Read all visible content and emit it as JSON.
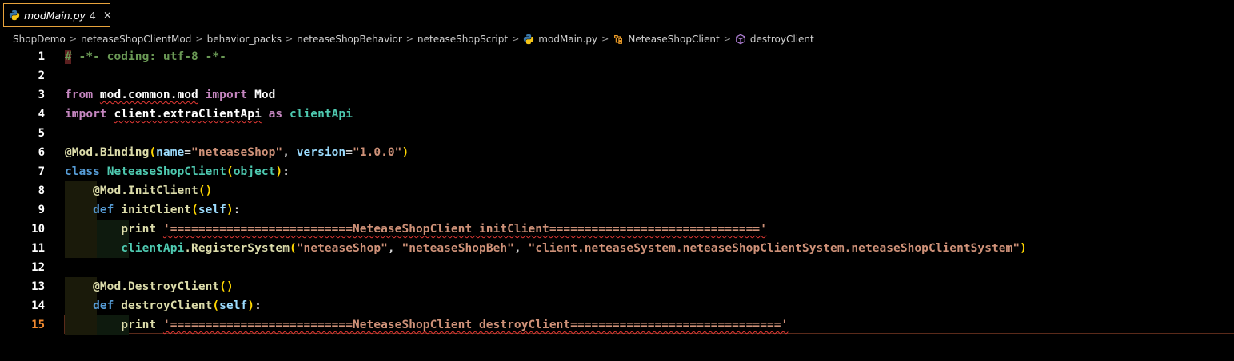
{
  "tab": {
    "title": "modMain.py",
    "badge": "4",
    "close": "×"
  },
  "breadcrumb": {
    "items": [
      "ShopDemo",
      "neteaseShopClientMod",
      "behavior_packs",
      "neteaseShopBehavior",
      "neteaseShopScript",
      "modMain.py",
      "NeteaseShopClient",
      "destroyClient"
    ],
    "separator": ">"
  },
  "editor": {
    "active_line": "15",
    "lines": [
      {
        "n": "1",
        "tokens": [
          {
            "t": "# -*- coding: utf-8 -*-",
            "c": "c-comment"
          }
        ]
      },
      {
        "n": "2",
        "tokens": []
      },
      {
        "n": "3",
        "tokens": [
          {
            "t": "from ",
            "c": "c-kw"
          },
          {
            "t": "mod.common.mod",
            "c": "c-module squiggle"
          },
          {
            "t": " import ",
            "c": "c-kw"
          },
          {
            "t": "Mod",
            "c": "c-module"
          }
        ]
      },
      {
        "n": "4",
        "tokens": [
          {
            "t": "import ",
            "c": "c-kw"
          },
          {
            "t": "client.extraClientApi",
            "c": "c-module squiggle"
          },
          {
            "t": " as ",
            "c": "c-kw"
          },
          {
            "t": "clientApi",
            "c": "c-class"
          }
        ]
      },
      {
        "n": "5",
        "tokens": []
      },
      {
        "n": "6",
        "tokens": [
          {
            "t": "@Mod.Binding",
            "c": "c-deco"
          },
          {
            "t": "(",
            "c": "c-paren1"
          },
          {
            "t": "name",
            "c": "c-param"
          },
          {
            "t": "=",
            "c": "c-plain"
          },
          {
            "t": "\"neteaseShop\"",
            "c": "c-string"
          },
          {
            "t": ", ",
            "c": "c-plain"
          },
          {
            "t": "version",
            "c": "c-param"
          },
          {
            "t": "=",
            "c": "c-plain"
          },
          {
            "t": "\"1.0.0\"",
            "c": "c-string"
          },
          {
            "t": ")",
            "c": "c-paren1"
          }
        ]
      },
      {
        "n": "7",
        "tokens": [
          {
            "t": "class ",
            "c": "c-def"
          },
          {
            "t": "NeteaseShopClient",
            "c": "c-class"
          },
          {
            "t": "(",
            "c": "c-paren1"
          },
          {
            "t": "object",
            "c": "c-class"
          },
          {
            "t": ")",
            "c": "c-paren1"
          },
          {
            "t": ":",
            "c": "c-plain"
          }
        ]
      },
      {
        "n": "8",
        "tokens": [
          {
            "t": "    ",
            "c": "c-plain"
          },
          {
            "t": "@Mod.InitClient",
            "c": "c-deco"
          },
          {
            "t": "()",
            "c": "c-paren1"
          }
        ]
      },
      {
        "n": "9",
        "tokens": [
          {
            "t": "    ",
            "c": "c-plain"
          },
          {
            "t": "def ",
            "c": "c-def"
          },
          {
            "t": "initClient",
            "c": "c-func"
          },
          {
            "t": "(",
            "c": "c-paren1"
          },
          {
            "t": "self",
            "c": "c-self"
          },
          {
            "t": ")",
            "c": "c-paren1"
          },
          {
            "t": ":",
            "c": "c-plain"
          }
        ]
      },
      {
        "n": "10",
        "tokens": [
          {
            "t": "        ",
            "c": "c-plain"
          },
          {
            "t": "print ",
            "c": "c-func"
          },
          {
            "t": "'==========================NeteaseShopClient initClient=============================='",
            "c": "c-string squiggle"
          }
        ]
      },
      {
        "n": "11",
        "tokens": [
          {
            "t": "        ",
            "c": "c-plain"
          },
          {
            "t": "clientApi",
            "c": "c-class"
          },
          {
            "t": ".RegisterSystem",
            "c": "c-func"
          },
          {
            "t": "(",
            "c": "c-paren1"
          },
          {
            "t": "\"neteaseShop\"",
            "c": "c-string"
          },
          {
            "t": ", ",
            "c": "c-plain"
          },
          {
            "t": "\"neteaseShopBeh\"",
            "c": "c-string"
          },
          {
            "t": ", ",
            "c": "c-plain"
          },
          {
            "t": "\"client.neteaseSystem.neteaseShopClientSystem.neteaseShopClientSystem\"",
            "c": "c-string"
          },
          {
            "t": ")",
            "c": "c-paren1"
          }
        ]
      },
      {
        "n": "12",
        "tokens": []
      },
      {
        "n": "13",
        "tokens": [
          {
            "t": "    ",
            "c": "c-plain"
          },
          {
            "t": "@Mod.DestroyClient",
            "c": "c-deco"
          },
          {
            "t": "()",
            "c": "c-paren1"
          }
        ]
      },
      {
        "n": "14",
        "tokens": [
          {
            "t": "    ",
            "c": "c-plain"
          },
          {
            "t": "def ",
            "c": "c-def"
          },
          {
            "t": "destroyClient",
            "c": "c-func"
          },
          {
            "t": "(",
            "c": "c-paren1"
          },
          {
            "t": "self",
            "c": "c-self"
          },
          {
            "t": ")",
            "c": "c-paren1"
          },
          {
            "t": ":",
            "c": "c-plain"
          }
        ]
      },
      {
        "n": "15",
        "tokens": [
          {
            "t": "        ",
            "c": "c-plain"
          },
          {
            "t": "print ",
            "c": "c-func"
          },
          {
            "t": "'==========================NeteaseShopClient destroyClient=============================='",
            "c": "c-string squiggle"
          }
        ]
      }
    ]
  }
}
